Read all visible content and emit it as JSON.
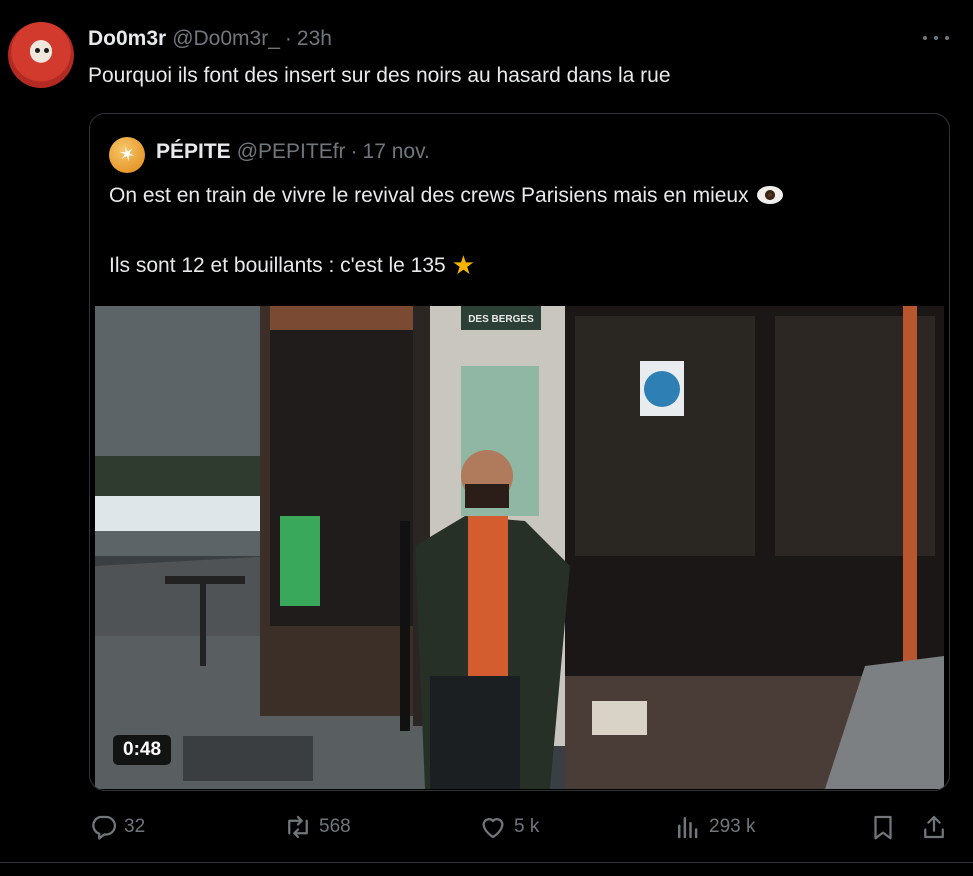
{
  "tweet": {
    "author_name": "Do0m3r",
    "handle": "@Do0m3r_",
    "time": "23h",
    "text": "Pourquoi ils font des insert sur des noirs au hasard dans la rue"
  },
  "quote": {
    "author_name": "PÉPITE",
    "handle": "@PEPITEfr",
    "time": "17 nov.",
    "line1": "On est en train de vivre le revival des crews Parisiens mais en mieux",
    "line2": "Ils sont 12 et bouillants : c'est le 135",
    "video_duration": "0:48",
    "video_signs": {
      "sign_top": "DES BERGES"
    }
  },
  "separator": "·",
  "actions": {
    "replies": "32",
    "reposts": "568",
    "likes": "5 k",
    "views": "293 k"
  },
  "icons": {
    "more": "more-icon",
    "reply": "reply-icon",
    "repost": "repost-icon",
    "like": "heart-icon",
    "views": "views-icon",
    "bookmark": "bookmark-icon",
    "share": "share-icon"
  },
  "colors": {
    "background": "#000000",
    "text": "#e7e9ea",
    "muted": "#71767b",
    "border": "#2f3336"
  }
}
